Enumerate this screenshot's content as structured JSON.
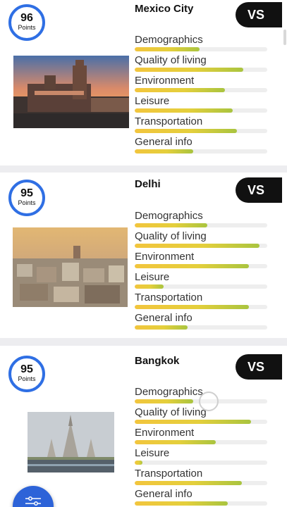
{
  "points_label": "Points",
  "vs_label": "VS",
  "metric_labels": [
    "Demographics",
    "Quality of living",
    "Environment",
    "Leisure",
    "Transportation",
    "General info"
  ],
  "cities": [
    {
      "name": "Mexico City",
      "score": "96",
      "metrics": [
        0.49,
        0.82,
        0.68,
        0.74,
        0.77,
        0.44
      ]
    },
    {
      "name": "Delhi",
      "score": "95",
      "metrics": [
        0.55,
        0.94,
        0.86,
        0.22,
        0.86,
        0.4
      ]
    },
    {
      "name": "Bangkok",
      "score": "95",
      "metrics": [
        0.44,
        0.88,
        0.61,
        0.06,
        0.81,
        0.7
      ]
    }
  ],
  "fab_icon": "sliders-icon",
  "colors": {
    "badge_ring": "#2f6fe4",
    "vs_button": "#111111",
    "fab": "#2d63d8",
    "bar_start": "#f2c53d",
    "bar_end": "#a9c43f"
  }
}
